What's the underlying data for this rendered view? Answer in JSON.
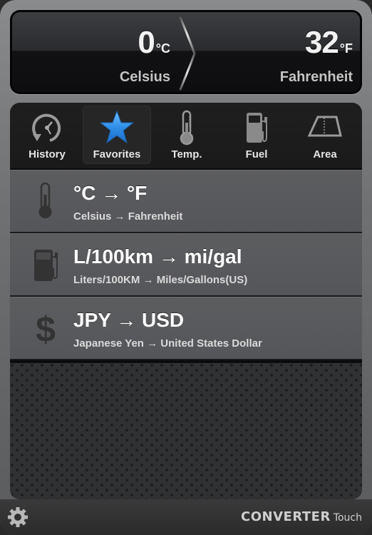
{
  "display": {
    "from_value": "0",
    "from_unit": "°C",
    "from_name": "Celsius",
    "to_value": "32",
    "to_unit": "°F",
    "to_name": "Fahrenheit",
    "divider_icon": "chevron-right-icon"
  },
  "tabs": [
    {
      "label": "History",
      "icon": "history-clock-icon",
      "active": false
    },
    {
      "label": "Favorites",
      "icon": "star-icon",
      "active": true
    },
    {
      "label": "Temp.",
      "icon": "thermometer-icon",
      "active": false
    },
    {
      "label": "Fuel",
      "icon": "fuel-pump-icon",
      "active": false
    },
    {
      "label": "Area",
      "icon": "area-trapezoid-icon",
      "active": false
    }
  ],
  "favorites": [
    {
      "title": "°C → °F",
      "subtitle": "Celsius → Fahrenheit",
      "icon": "thermometer-icon"
    },
    {
      "title": "L/100km → mi/gal",
      "subtitle": "Liters/100KM → Miles/Gallons(US)",
      "icon": "fuel-pump-icon"
    },
    {
      "title": "JPY → USD",
      "subtitle": "Japanese Yen → United States Dollar",
      "icon": "dollar-icon"
    }
  ],
  "footer": {
    "settings_icon": "gear-icon",
    "brand_main": "CONVERTER",
    "brand_sub": "Touch"
  },
  "colors": {
    "accent_star": "#3a9bf0",
    "display_bg": "#0e0e10",
    "row_bg": "#5a5b5d"
  }
}
